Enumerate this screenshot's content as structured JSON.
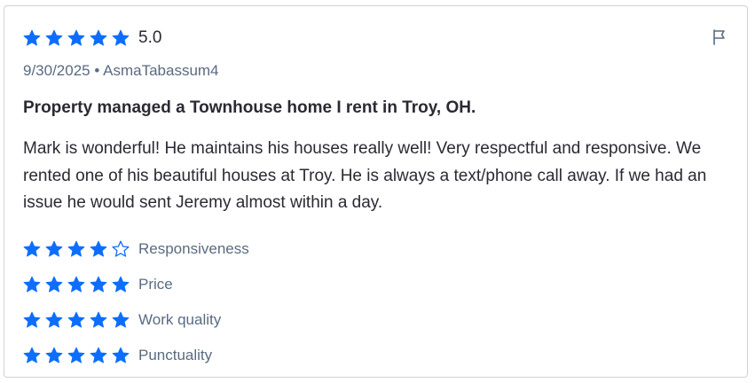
{
  "colors": {
    "star_filled": "#0d6efd",
    "star_empty_outline": "#0d6efd",
    "meta_text": "#596b82",
    "body_text": "#2a2a33",
    "border": "#d1d1d5"
  },
  "review": {
    "overall_rating": 5,
    "overall_score_label": "5.0",
    "date": "9/30/2025",
    "separator": "•",
    "author": "AsmaTabassum4",
    "meta_text": "9/30/2025 • AsmaTabassum4",
    "title": "Property managed a Townhouse home I rent in Troy, OH.",
    "body": "Mark is wonderful! He maintains his houses really well! Very respectful and responsive. We rented one of his beautiful houses at Troy. He is always a text/phone call away. If we had an issue he would sent Jeremy almost within a day.",
    "flag_icon": "flag-icon",
    "sub_ratings": [
      {
        "label": "Responsiveness",
        "rating": 4
      },
      {
        "label": "Price",
        "rating": 5
      },
      {
        "label": "Work quality",
        "rating": 5
      },
      {
        "label": "Punctuality",
        "rating": 5
      }
    ]
  }
}
